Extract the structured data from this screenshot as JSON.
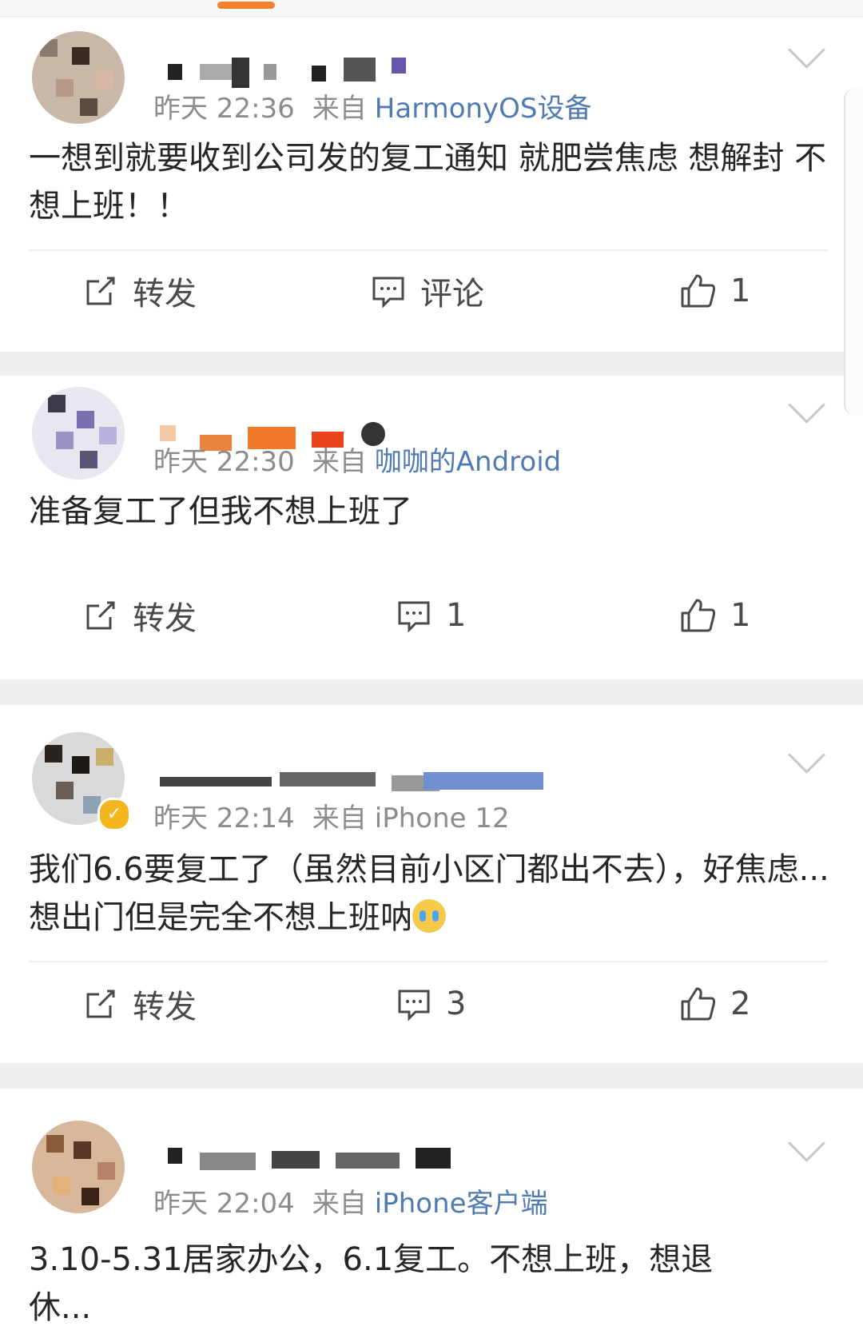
{
  "posts": [
    {
      "time": "昨天 22:36",
      "source_label": "来自",
      "source": "HarmonyOS设备",
      "text": "一想到就要收到公司发的复工通知 就肥尝焦虑 想解封 不想上班！！",
      "actions": {
        "repost": "转发",
        "comment": "评论",
        "like": "1"
      }
    },
    {
      "time": "昨天 22:30",
      "source_label": "来自",
      "source": "咖咖的Android",
      "text": "准备复工了但我不想上班了",
      "actions": {
        "repost": "转发",
        "comment": "1",
        "like": "1"
      }
    },
    {
      "time": "昨天 22:14",
      "source_label": "来自",
      "source": "iPhone 12",
      "text": "我们6.6要复工了（虽然目前小区门都出不去），好焦虑...想出门但是完全不想上班呐",
      "actions": {
        "repost": "转发",
        "comment": "3",
        "like": "2"
      }
    },
    {
      "time": "昨天 22:04",
      "source_label": "来自",
      "source": "iPhone客户端",
      "text": "3.10-5.31居家办公，6.1复工。不想上班，想退休..."
    }
  ],
  "colors": {
    "accent": "#f5822a",
    "link": "#4f7ab3",
    "meta": "#8c8c8c",
    "text": "#262626"
  },
  "icons": [
    "repost-icon",
    "comment-icon",
    "like-icon",
    "chevron-down-icon",
    "crying-emoji",
    "verified-badge-icon"
  ]
}
